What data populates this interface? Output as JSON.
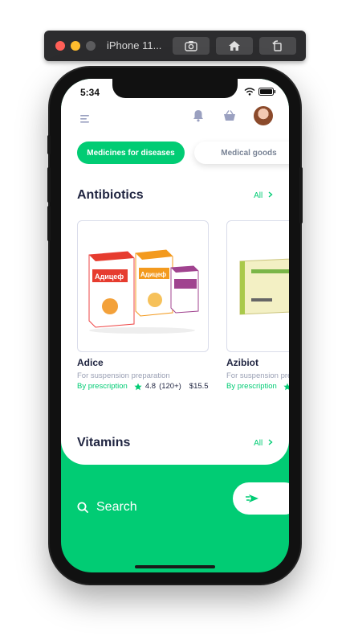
{
  "simulator": {
    "title": "iPhone 11...",
    "buttons": [
      "screenshot-icon",
      "home-icon",
      "rotate-icon"
    ]
  },
  "status": {
    "time": "5:34"
  },
  "header": {
    "icons": [
      "menu-icon",
      "bell-icon",
      "basket-icon",
      "avatar"
    ]
  },
  "tabs": [
    {
      "label": "Medicines for diseases",
      "active": true
    },
    {
      "label": "Medical goods",
      "active": false
    }
  ],
  "sections": {
    "antibiotics": {
      "title": "Antibiotics",
      "all_label": "All",
      "products": [
        {
          "name": "Adice",
          "box_text": "Адицеф",
          "description": "For suspension preparation",
          "prescription": "By prescription",
          "rating": "4.8",
          "reviews": "(120+)",
          "price": "$15.5"
        },
        {
          "name": "Azibiot",
          "description": "For suspension preparation",
          "prescription": "By prescription"
        }
      ]
    },
    "vitamins": {
      "title": "Vitamins",
      "all_label": "All"
    }
  },
  "search": {
    "label": "Search"
  },
  "colors": {
    "accent": "#01cc74",
    "dark_text": "#1f2440",
    "muted_text": "#9aa0b4"
  }
}
